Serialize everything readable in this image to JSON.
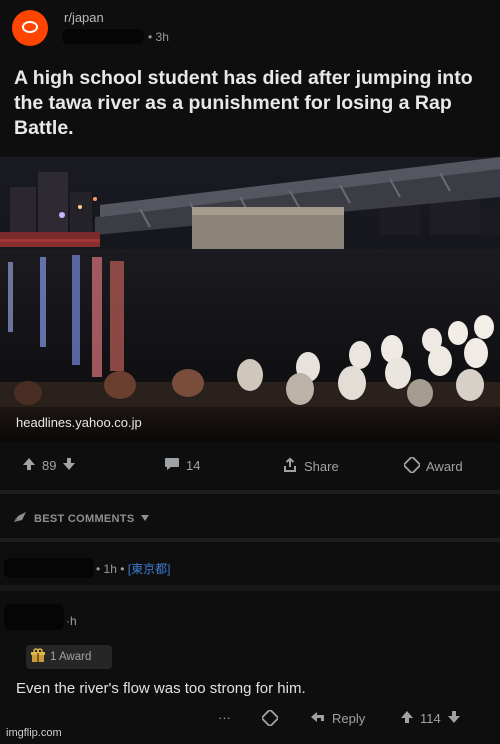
{
  "header": {
    "subreddit": "r/japan",
    "time": "• 3h"
  },
  "post": {
    "title": "A high school student has died after jumping into the tawa river as a punishment for losing a Rap Battle.",
    "domain": "headlines.yahoo.co.jp",
    "score": "89",
    "comments": "14",
    "share_label": "Share",
    "award_label": "Award"
  },
  "best_comments_label": "BEST COMMENTS",
  "comments": [
    {
      "time": "• 1h •",
      "location": "[東京都]"
    },
    {
      "time": "·h",
      "award_label": "1 Award",
      "text": "Even the river's flow was too strong for him.",
      "more": "···",
      "reply_label": "Reply",
      "score": "114"
    }
  ],
  "footer": {
    "watermark": "imgflip.com"
  },
  "colors": {
    "accent": "#ff4500",
    "flair": "#3f7bd1",
    "background": "#0e0e0e"
  }
}
